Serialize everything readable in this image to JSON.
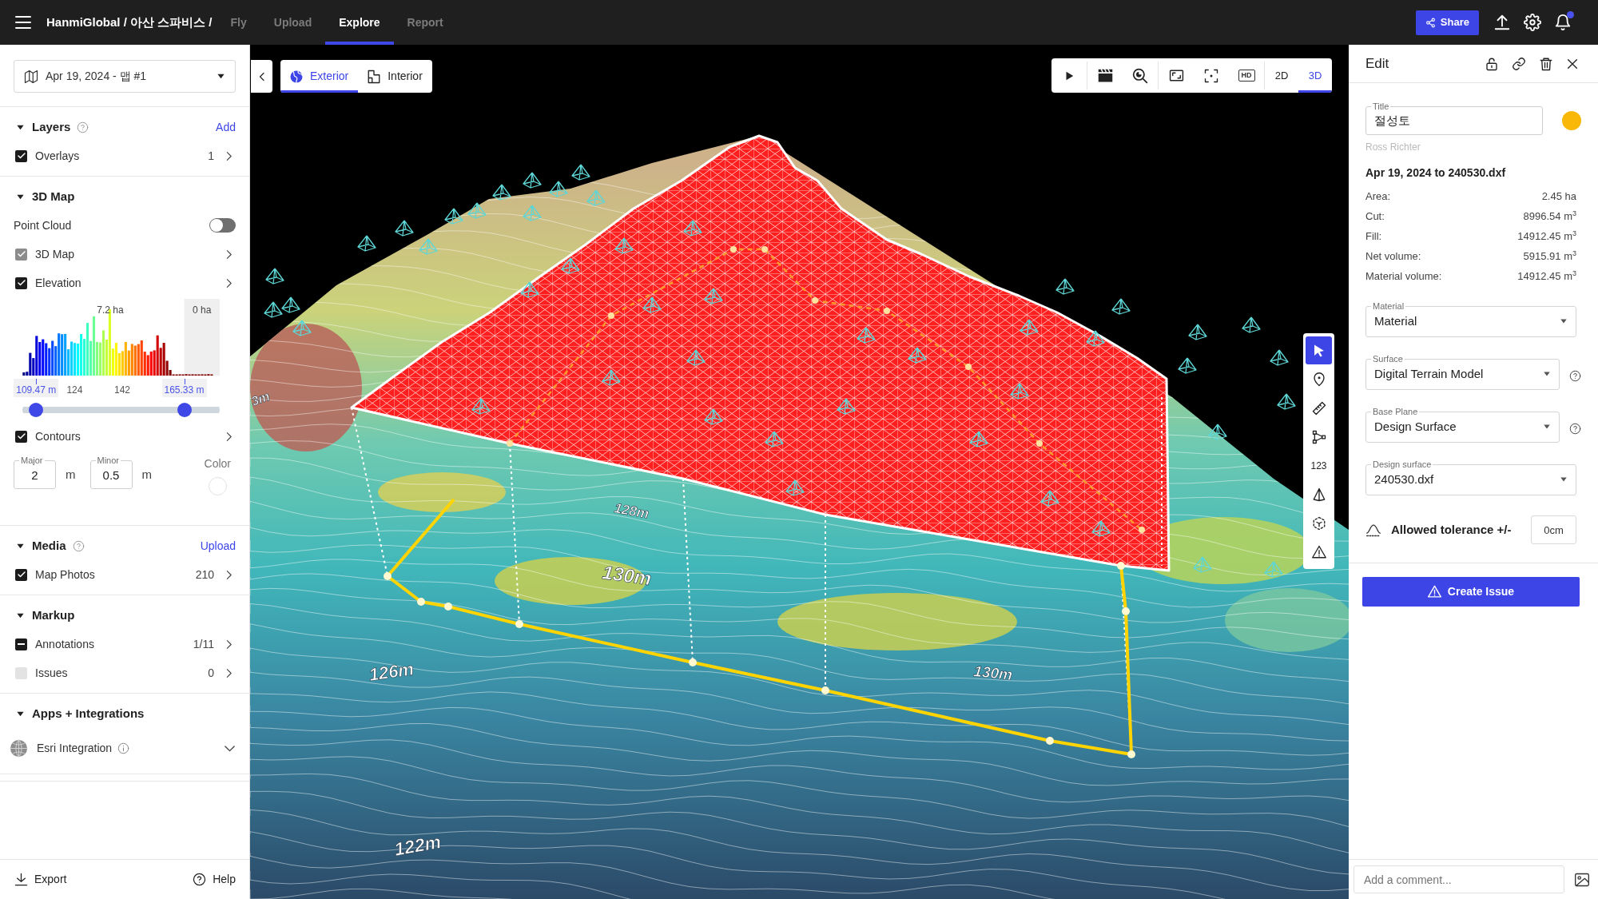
{
  "topbar": {
    "breadcrumb": "HanmiGlobal / 아산 스파비스 /",
    "nav": [
      {
        "label": "Fly",
        "selected": false
      },
      {
        "label": "Upload",
        "selected": false
      },
      {
        "label": "Explore",
        "selected": true
      },
      {
        "label": "Report",
        "selected": false
      }
    ],
    "share_label": "Share",
    "unread": true
  },
  "sidebar": {
    "map_selector": "Apr 19, 2024 - 맵 #1",
    "sections": [
      {
        "title": "Layers",
        "help": true,
        "action": "Add",
        "expanded": true,
        "rows": [
          {
            "kind": "check",
            "label": "Overlays",
            "checked": true,
            "disabled": false,
            "indeterminate": false,
            "count": "1"
          }
        ]
      },
      {
        "title": "3D Map",
        "help": false,
        "expanded": true,
        "rows": [
          {
            "kind": "toggle",
            "label": "Point Cloud",
            "on": false
          },
          {
            "kind": "check",
            "label": "3D Map",
            "checked": true,
            "disabled": true,
            "indeterminate": false
          },
          {
            "kind": "check",
            "label": "Elevation",
            "checked": true,
            "disabled": false,
            "indeterminate": false
          },
          {
            "kind": "histogram",
            "total_label": "7.2 ha",
            "excluded_label": "0 ha",
            "axis_ticks": [
              "124",
              "142"
            ],
            "thumbs": [
              {
                "label": "109.47 m",
                "level": 0.07
              },
              {
                "label": "165.33 m",
                "level": 0.82
              }
            ]
          },
          {
            "kind": "check",
            "label": "Contours",
            "checked": true,
            "disabled": false,
            "indeterminate": false
          },
          {
            "kind": "contour_inputs",
            "fields": [
              {
                "label": "Major",
                "value": "2",
                "unit": "m"
              },
              {
                "label": "Minor",
                "value": "0.5",
                "unit": "m"
              }
            ],
            "color_label": "Color"
          }
        ]
      },
      {
        "title": "Media",
        "help": true,
        "action": "Upload",
        "expanded": true,
        "rows": [
          {
            "kind": "check",
            "label": "Map Photos",
            "checked": true,
            "disabled": false,
            "indeterminate": false,
            "count": "210"
          }
        ]
      },
      {
        "title": "Markup",
        "help": false,
        "expanded": true,
        "rows": [
          {
            "kind": "check",
            "label": "Annotations",
            "checked": true,
            "disabled": false,
            "indeterminate": true,
            "count": "1/11"
          },
          {
            "kind": "check",
            "label": "Issues",
            "checked": false,
            "disabled": true,
            "indeterminate": false,
            "count": "0"
          }
        ]
      },
      {
        "title": "Apps + Integrations",
        "help": false,
        "expanded": true,
        "rows": [
          {
            "kind": "integration",
            "label": "Esri Integration",
            "expanded": false
          }
        ]
      }
    ],
    "footer": {
      "export": "Export",
      "help": "Help"
    }
  },
  "map": {
    "view_tabs": [
      {
        "label": "Exterior",
        "selected": true
      },
      {
        "label": "Interior",
        "selected": false
      }
    ],
    "toolbar": {
      "quality_label": "HD",
      "dimension_tabs": [
        {
          "label": "2D",
          "selected": false
        },
        {
          "label": "3D",
          "selected": true
        }
      ]
    },
    "tools": [
      {
        "selected": true
      },
      {
        "selected": false
      },
      {
        "selected": false
      },
      {
        "selected": false
      },
      {
        "label": "123",
        "selected": false
      },
      {
        "selected": false
      },
      {
        "selected": false
      },
      {
        "selected": false
      }
    ],
    "contour_labels": [
      "3m",
      "128m",
      "130m",
      "126m",
      "130m",
      "122m"
    ]
  },
  "edit_panel": {
    "title": "Edit",
    "name_field": {
      "label": "Title",
      "value": "절성토"
    },
    "color": "#f9b707",
    "author": "Ross Richter",
    "comparison": "Apr 19, 2024 to 240530.dxf",
    "stats": [
      {
        "label": "Area:",
        "value": "2.45 ha"
      },
      {
        "label": "Cut:",
        "value": "8996.54 m$^{3}$"
      },
      {
        "label": "Fill:",
        "value": "14912.45 m$^{3}$"
      },
      {
        "label": "Net volume:",
        "value": "5915.91 m$^{3}$"
      },
      {
        "label": "Material volume:",
        "value": "14912.45 m$^{3}$"
      }
    ],
    "selects": [
      {
        "label": "Material",
        "value": "Material",
        "help": false
      },
      {
        "label": "Surface",
        "value": "Digital Terrain Model",
        "help": true
      },
      {
        "label": "Base Plane",
        "value": "Design Surface",
        "help": true
      },
      {
        "label": "Design surface",
        "value": "240530.dxf",
        "help": false
      }
    ],
    "tolerance": {
      "label": "Allowed tolerance +/-",
      "value": "0cm"
    },
    "create_button": "Create Issue",
    "comment_placeholder": "Add a comment..."
  }
}
